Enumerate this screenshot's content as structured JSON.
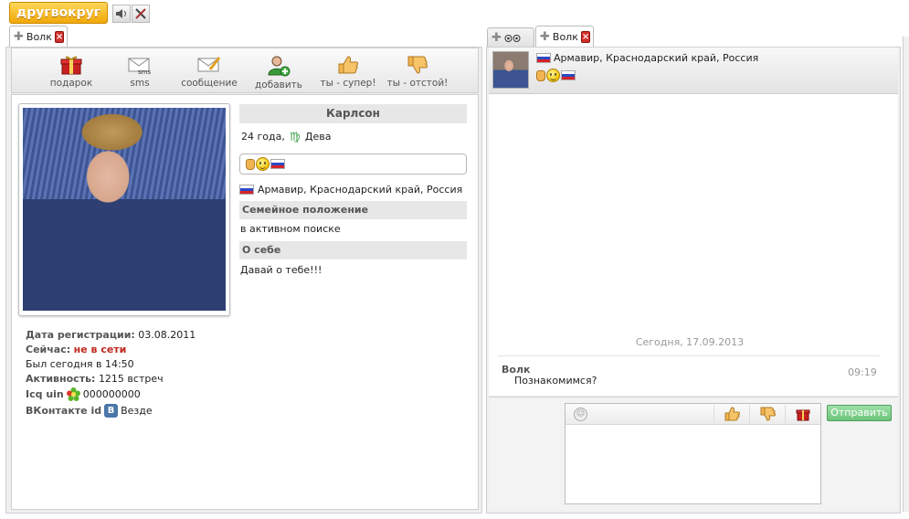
{
  "app": {
    "logo": "другвокруг"
  },
  "left_tab": {
    "label": "Волк"
  },
  "right_tabs": [
    {
      "label": ""
    },
    {
      "label": "Волк"
    }
  ],
  "toolbar": {
    "gift": "подарок",
    "sms": "sms",
    "message": "сообщение",
    "add": "добавить",
    "like": "ты - супер!",
    "dislike": "ты - отстой!",
    "sms_icon_text": "sms"
  },
  "profile": {
    "name": "Карлсон",
    "age": "24 года,",
    "zodiac": "Дева",
    "location": "Армавир, Краснодарский край, Россия",
    "family_heading": "Семейное положение",
    "family_value": "в активном поиске",
    "about_heading": "О себе",
    "about_value": "Давай о тебе!!!"
  },
  "details": {
    "reg_label": "Дата регистрации:",
    "reg_value": "03.08.2011",
    "now_label": "Сейчас:",
    "now_value": "не в сети",
    "last_seen": "Был сегодня в 14:50",
    "activity_label": "Активность:",
    "activity_value": "1215 встреч",
    "icq_label": "Icq uin",
    "icq_value": "000000000",
    "vk_label": "ВКонтакте id",
    "vk_value": "Везде"
  },
  "chat": {
    "header_location": "Армавир, Краснодарский край, Россия",
    "date_divider": "Сегодня, 17.09.2013",
    "messages": [
      {
        "author": "Волк",
        "text": "Познакомимся?",
        "time": "09:19"
      }
    ],
    "send_label": "Отправить"
  },
  "colors": {
    "accent_orange": "#f0a80a",
    "offline_red": "#c0281e",
    "send_green": "#7fcf8a"
  }
}
